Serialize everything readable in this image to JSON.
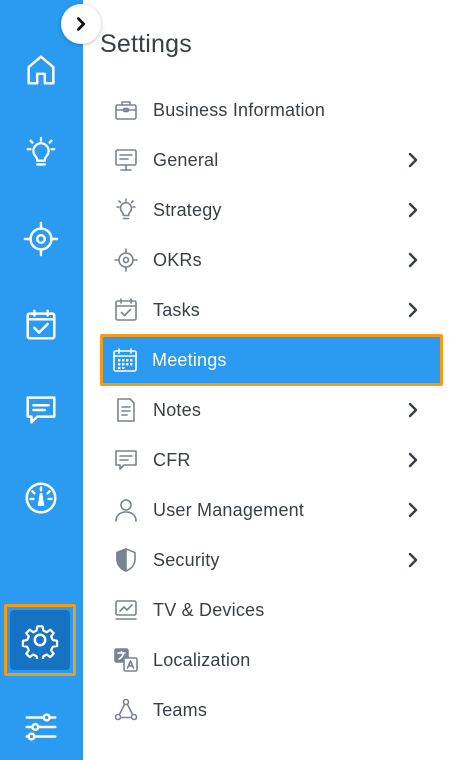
{
  "colors": {
    "rail": "#2a9bf0",
    "rail_active": "#1673c4",
    "highlight": "#f39b16",
    "text": "#3a3f47",
    "icon": "#7a8390"
  },
  "sidebar": {
    "icons": [
      "home-icon",
      "lightbulb-icon",
      "target-icon",
      "calendar-check-icon",
      "chat-icon",
      "gauge-icon",
      "gear-icon",
      "sliders-icon"
    ],
    "active": "gear-icon"
  },
  "panel": {
    "title": "Settings"
  },
  "menu": {
    "items": [
      {
        "label": "Business Information",
        "icon": "briefcase-icon",
        "has_submenu": false
      },
      {
        "label": "General",
        "icon": "presentation-icon",
        "has_submenu": true
      },
      {
        "label": "Strategy",
        "icon": "lightbulb-icon",
        "has_submenu": true
      },
      {
        "label": "OKRs",
        "icon": "target-icon",
        "has_submenu": true
      },
      {
        "label": "Tasks",
        "icon": "calendar-check-icon",
        "has_submenu": true
      },
      {
        "label": "Meetings",
        "icon": "calendar-grid-icon",
        "has_submenu": false,
        "active": true
      },
      {
        "label": "Notes",
        "icon": "document-icon",
        "has_submenu": true
      },
      {
        "label": "CFR",
        "icon": "chat-icon",
        "has_submenu": true
      },
      {
        "label": "User Management",
        "icon": "user-icon",
        "has_submenu": true
      },
      {
        "label": "Security",
        "icon": "shield-icon",
        "has_submenu": true
      },
      {
        "label": "TV & Devices",
        "icon": "monitor-icon",
        "has_submenu": false
      },
      {
        "label": "Localization",
        "icon": "translate-icon",
        "has_submenu": false
      },
      {
        "label": "Teams",
        "icon": "team-icon",
        "has_submenu": false
      }
    ]
  }
}
